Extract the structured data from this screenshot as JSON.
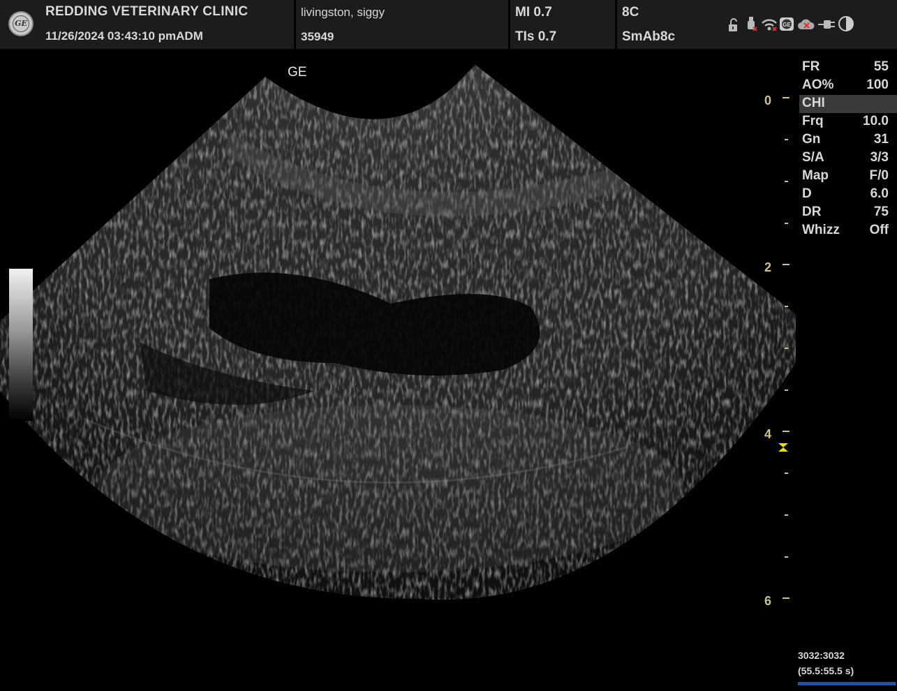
{
  "header": {
    "clinic_name": "REDDING VETERINARY CLINIC",
    "datetime": "11/26/2024  03:43:10 pmADM",
    "patient_name": "livingston, siggy",
    "patient_id": "35949",
    "mi": "MI 0.7",
    "tis": "TIs 0.7",
    "probe": "8C",
    "preset": "SmAb8c",
    "logo_text": "GE",
    "status_icons": [
      "unlock-icon",
      "usb-icon",
      "wifi-icon",
      "ge-network-icon",
      "cloud-error-icon",
      "power-plug-icon",
      "contrast-icon"
    ]
  },
  "image": {
    "orientation_label": "GE",
    "depth_labels": [
      "0",
      "2",
      "4",
      "6"
    ]
  },
  "params": [
    {
      "label": "FR",
      "value": "55"
    },
    {
      "label": "AO%",
      "value": "100"
    },
    {
      "label": "CHI",
      "value": ""
    },
    {
      "label": "Frq",
      "value": "10.0"
    },
    {
      "label": "Gn",
      "value": "31"
    },
    {
      "label": "S/A",
      "value": "3/3"
    },
    {
      "label": "Map",
      "value": "F/0"
    },
    {
      "label": "D",
      "value": "6.0"
    },
    {
      "label": "DR",
      "value": "75"
    },
    {
      "label": "Whizz",
      "value": "Off"
    }
  ],
  "cine": {
    "frames": "3032:3032",
    "time": "(55.5:55.5 s)"
  },
  "colors": {
    "depth_scale": "#c8c48a",
    "focus_marker": "#e8e000",
    "cine_bar": "#1d50b8"
  }
}
